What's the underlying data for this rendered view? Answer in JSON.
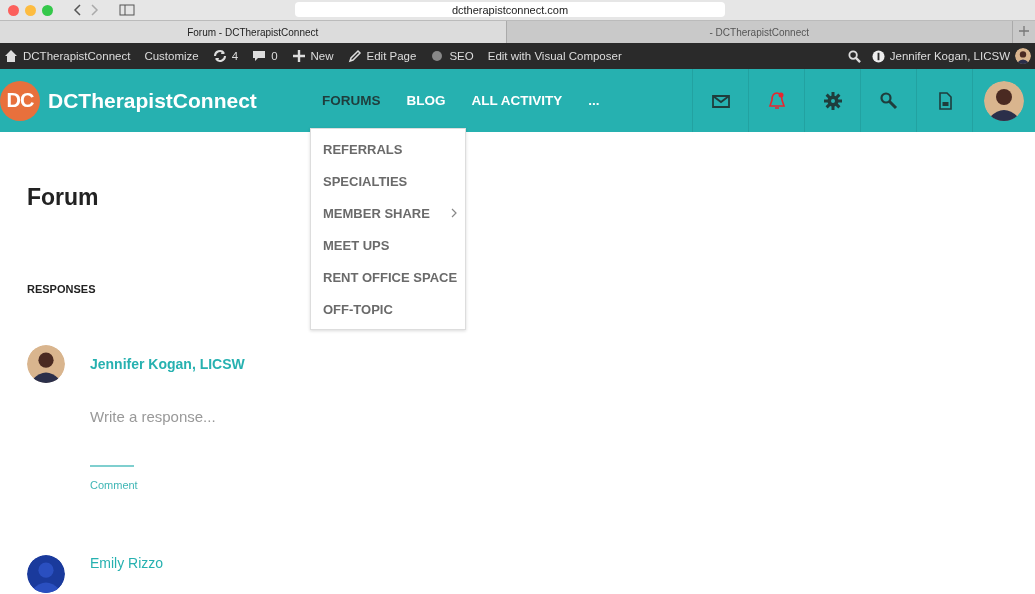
{
  "browser": {
    "url": "dctherapistconnect.com",
    "tabs": [
      {
        "title": "Forum - DCTherapistConnect",
        "selected": true
      },
      {
        "title": "- DCTherapistConnect",
        "selected": false
      }
    ]
  },
  "admin_bar": {
    "items": [
      {
        "kind": "home",
        "label": "DCTherapistConnect"
      },
      {
        "kind": "text",
        "label": "Customize"
      },
      {
        "kind": "updates",
        "label": "4"
      },
      {
        "kind": "comments",
        "label": "0"
      },
      {
        "kind": "plus",
        "label": "New"
      },
      {
        "kind": "pencil",
        "label": "Edit Page"
      },
      {
        "kind": "dot",
        "label": "SEO"
      },
      {
        "kind": "text",
        "label": "Edit with Visual Composer"
      }
    ],
    "user": "Jennifer Kogan, LICSW"
  },
  "header": {
    "logo_mark": "DC",
    "site_name": "DCTherapistConnect",
    "nav": [
      {
        "label": "FORUMS",
        "selected": true
      },
      {
        "label": "BLOG",
        "selected": false
      },
      {
        "label": "ALL ACTIVITY",
        "selected": false
      },
      {
        "label": "...",
        "selected": false
      }
    ],
    "dropdown": [
      {
        "label": "REFERRALS",
        "has_submenu": false
      },
      {
        "label": "SPECIALTIES",
        "has_submenu": false
      },
      {
        "label": "MEMBER SHARE",
        "has_submenu": true
      },
      {
        "label": "MEET UPS",
        "has_submenu": false
      },
      {
        "label": "RENT OFFICE SPACE",
        "has_submenu": false
      },
      {
        "label": "OFF-TOPIC",
        "has_submenu": false
      }
    ],
    "icons": [
      {
        "kind": "mail",
        "alert": false
      },
      {
        "kind": "bell",
        "alert": true
      },
      {
        "kind": "gear",
        "alert": false
      },
      {
        "kind": "search",
        "alert": false
      },
      {
        "kind": "document",
        "alert": false
      }
    ]
  },
  "page": {
    "title": "Forum",
    "section": "RESPONSES",
    "composer": {
      "author": "Jennifer Kogan, LICSW",
      "placeholder": "Write a response...",
      "submit": "Comment"
    },
    "next_response": {
      "author": "Emily Rizzo"
    }
  }
}
